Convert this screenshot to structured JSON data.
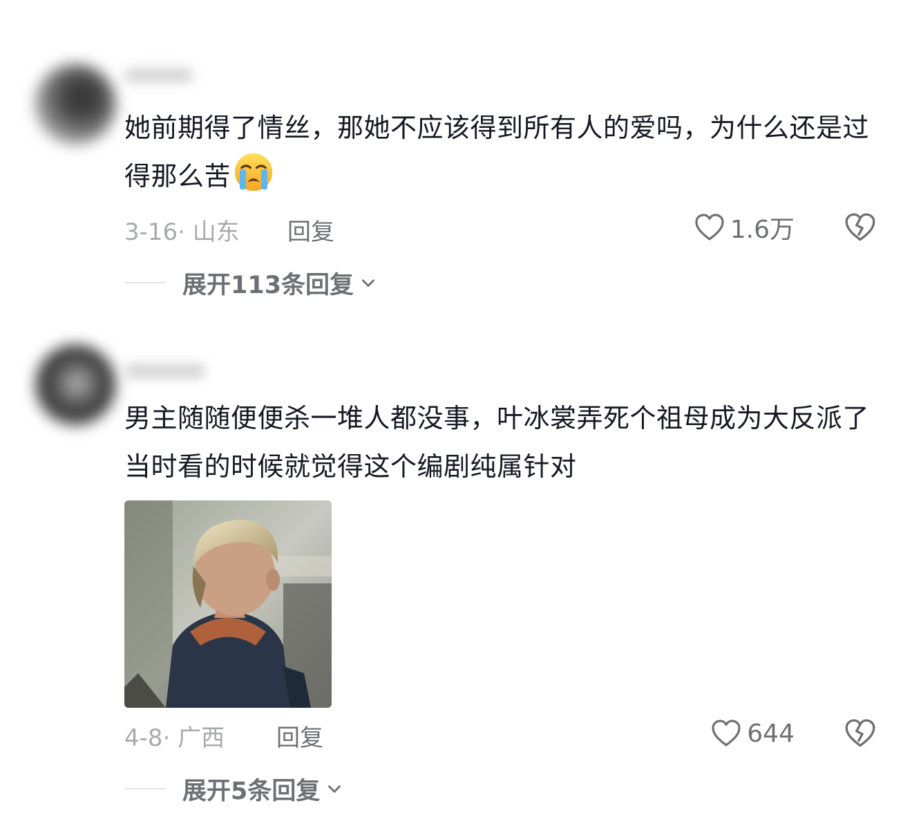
{
  "comments": [
    {
      "text": "她前期得了情丝，那她不应该得到所有人的爱吗，为什么还是过得那么苦",
      "emoji": "loudly-crying-face",
      "date": "3-16",
      "location": "山东",
      "reply_label": "回复",
      "likes": "1.6万",
      "expand_label": "展开113条回复"
    },
    {
      "text": "男主随随便便杀一堆人都没事，叶冰裳弄死个祖母成为大反派了      当时看的时候就觉得这个编剧纯属针对",
      "date": "4-8",
      "location": "广西",
      "reply_label": "回复",
      "likes": "644",
      "expand_label": "展开5条回复",
      "image_description": "gif-man-blond-hair-looking-away"
    }
  ],
  "colors": {
    "text": "#161823",
    "meta": "#a8a9ad",
    "action": "#6e6f74"
  }
}
